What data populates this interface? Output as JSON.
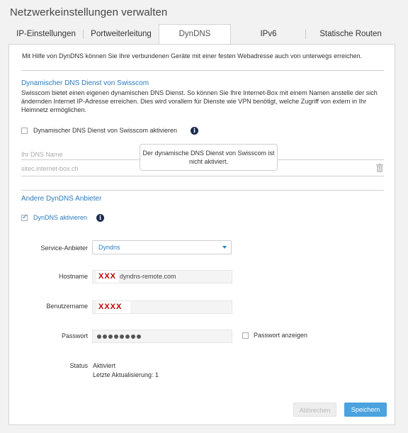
{
  "page_title": "Netzwerkeinstellungen verwalten",
  "tabs": [
    {
      "label": "IP-Einstellungen"
    },
    {
      "label": "Portweiterleitung"
    },
    {
      "label": "DynDNS"
    },
    {
      "label": "IPv6"
    },
    {
      "label": "Statische Routen"
    }
  ],
  "active_tab": "DynDNS",
  "intro": "Mit Hilfe von DynDNS können Sie Ihre verbundenen Geräte mit einer festen Webadresse auch von unterwegs erreichen.",
  "swisscom": {
    "title": "Dynamischer DNS Dienst von Swisscom",
    "description": "Swisscom bietet einen eigenen dynamischen DNS Dienst. So können Sie Ihre Internet-Box mit einem Namen anstelle der sich ändernden Internet IP-Adresse erreichen. Dies wird vorallem für Dienste wie VPN benötigt, welche Zugriff von extern in Ihr Heimnetz ermöglichen.",
    "checkbox_label": "Dynamischer DNS Dienst von Swisscom aktivieren",
    "checked": false,
    "dns_name_label": "Ihr DNS Name",
    "dns_name_value": "sitec.internet-box.ch",
    "tooltip": "Der dynamische DNS Dienst von Swisscom ist nicht aktiviert."
  },
  "other": {
    "title": "Andere DynDNS Anbieter",
    "checkbox_label": "DynDNS aktivieren",
    "checked": true,
    "service_label": "Service-Anbieter",
    "service_value": "Dyndns",
    "hostname_label": "Hostname",
    "hostname_redacted": "XXX",
    "hostname_value": "dyndns-remote.com",
    "username_label": "Benutzername",
    "username_redacted": "XXXX",
    "password_label": "Passwort",
    "password_dots": 8,
    "show_password_label": "Passwort anzeigen",
    "status_label": "Status",
    "status_value": "Aktiviert",
    "last_update": "Letzte Aktualisierung: 1"
  },
  "buttons": {
    "cancel": "Abbrechen",
    "save": "Speichern"
  },
  "colors": {
    "accent": "#2b7bc0",
    "save_button": "#4aa2de",
    "redaction": "#c00000"
  }
}
